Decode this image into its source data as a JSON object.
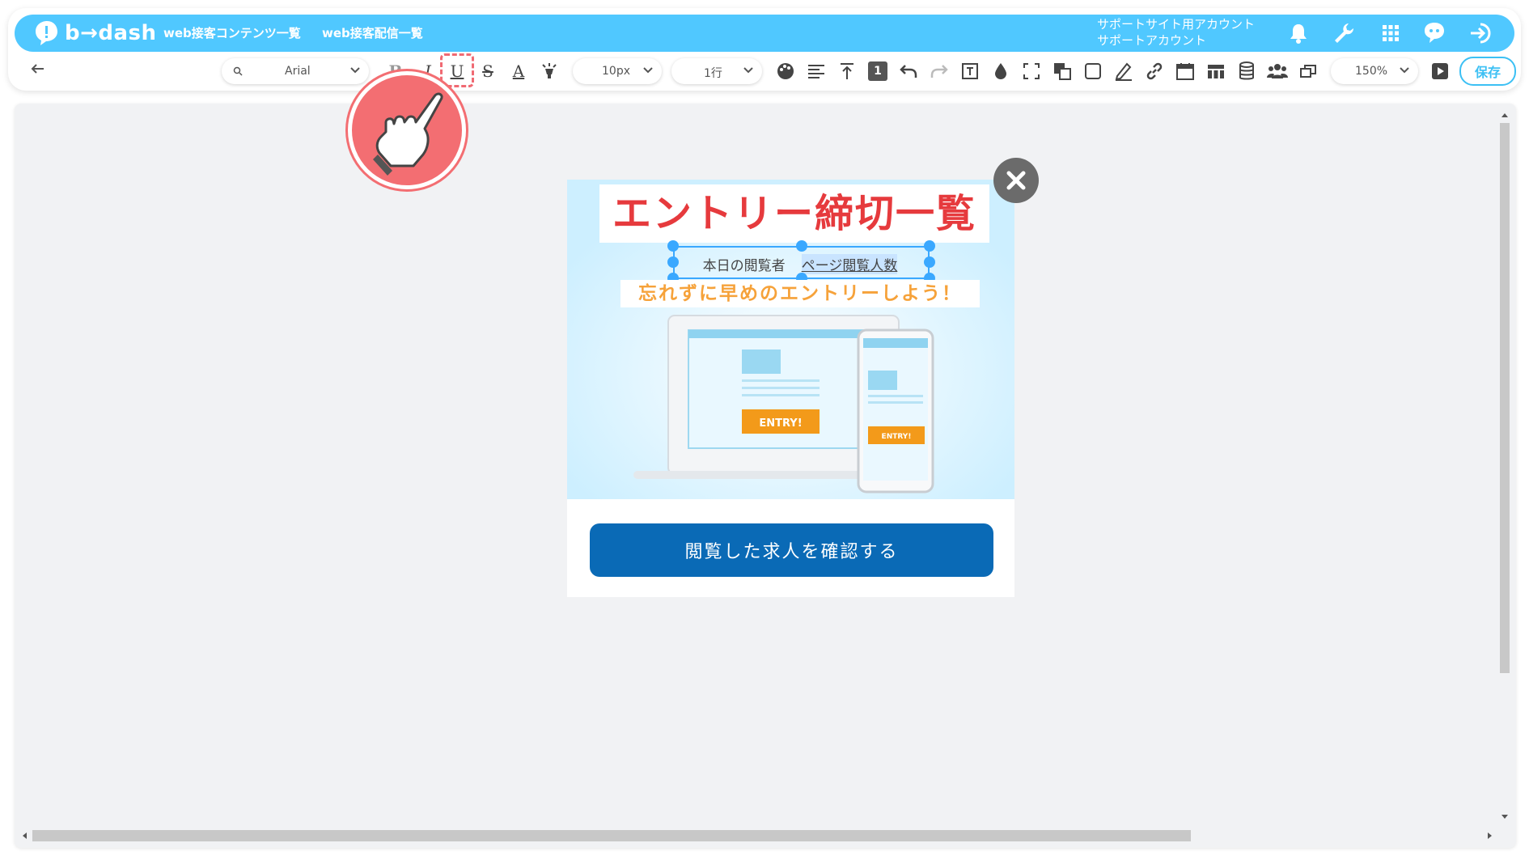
{
  "app": {
    "logo_text": "b→dash",
    "nav": [
      "web接客コンテンツ一覧",
      "web接客配信一覧"
    ],
    "account_line1": "サポートサイト用アカウント",
    "account_line2": "サポートアカウント"
  },
  "toolbar": {
    "font_family": "Arial",
    "font_size": "10px",
    "line_height": "1行",
    "block_number": "1",
    "zoom": "150%",
    "save_label": "保存",
    "bold_label": "B",
    "italic_label": "I",
    "underline_label": "U",
    "strike_label": "S",
    "color_label": "A"
  },
  "popup": {
    "title": "エントリー締切一覧",
    "viewer_label": "本日の閲覧者",
    "viewer_count": "ページ閲覧人数",
    "reminder": "忘れずに早めのエントリーしよう！",
    "entry_label_laptop": "ENTRY!",
    "entry_label_phone": "ENTRY!",
    "cta_label": "閲覧した求人を確認する"
  },
  "colors": {
    "header_bg": "#50c8ff",
    "accent": "#3cc0f4",
    "title_red": "#e63a3d",
    "reminder_orange": "#f6a23a",
    "cta_blue": "#0a6ab6",
    "pointer_pink": "#f36e72"
  }
}
